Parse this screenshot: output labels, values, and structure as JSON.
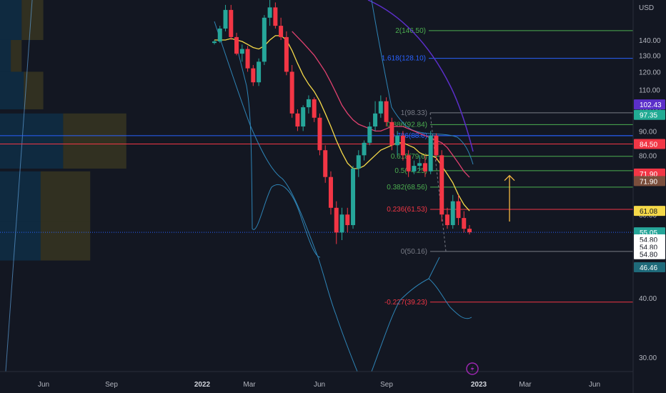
{
  "chart_data": {
    "type": "candlestick",
    "currency": "USD",
    "y_axis": {
      "scale": "log",
      "range": [
        28,
        170
      ],
      "ticks": [
        30,
        40,
        50,
        60,
        70,
        80,
        90,
        100,
        110,
        120,
        130,
        140
      ]
    },
    "x_axis": {
      "tick_labels": [
        "Jun",
        "Sep",
        "2022",
        "Mar",
        "Jun",
        "Sep",
        "2023",
        "Mar",
        "Jun"
      ],
      "bold_labels": [
        "2022",
        "2023"
      ]
    },
    "grid": false,
    "candles": [
      [
        138,
        140,
        137,
        139
      ],
      [
        139,
        150,
        138,
        148
      ],
      [
        148,
        166,
        146,
        162
      ],
      [
        162,
        166,
        140,
        142
      ],
      [
        142,
        145,
        130,
        131
      ],
      [
        131,
        137,
        126,
        134
      ],
      [
        134,
        136,
        120,
        122
      ],
      [
        122,
        124,
        112,
        114
      ],
      [
        114,
        128,
        112,
        126
      ],
      [
        126,
        158,
        124,
        156
      ],
      [
        156,
        170,
        150,
        164
      ],
      [
        164,
        168,
        148,
        150
      ],
      [
        150,
        156,
        140,
        142
      ],
      [
        142,
        146,
        118,
        120
      ],
      [
        120,
        124,
        96,
        98
      ],
      [
        98,
        100,
        90,
        92
      ],
      [
        92,
        102,
        90,
        101
      ],
      [
        101,
        107,
        98,
        105
      ],
      [
        105,
        106,
        94,
        96
      ],
      [
        96,
        98,
        80,
        82
      ],
      [
        82,
        84,
        70,
        72
      ],
      [
        72,
        74,
        60,
        62
      ],
      [
        62,
        64,
        52,
        55
      ],
      [
        55,
        62,
        53,
        60
      ],
      [
        60,
        62,
        55,
        57
      ],
      [
        57,
        76,
        56,
        75
      ],
      [
        75,
        82,
        72,
        80
      ],
      [
        80,
        86,
        78,
        85
      ],
      [
        85,
        94,
        84,
        92
      ],
      [
        92,
        104,
        90,
        98
      ],
      [
        98,
        107,
        96,
        104
      ],
      [
        104,
        106,
        92,
        94
      ],
      [
        94,
        96,
        82,
        84
      ],
      [
        84,
        90,
        80,
        88
      ],
      [
        88,
        90,
        78,
        80
      ],
      [
        80,
        82,
        72,
        74
      ],
      [
        74,
        78,
        73,
        76
      ],
      [
        76,
        80,
        74,
        77
      ],
      [
        77,
        80,
        72,
        74
      ],
      [
        74,
        90,
        73,
        88
      ],
      [
        88,
        89,
        78,
        80
      ],
      [
        80,
        82,
        58,
        60
      ],
      [
        60,
        62,
        56,
        57
      ],
      [
        57,
        66,
        56,
        64
      ],
      [
        64,
        66,
        57,
        59
      ],
      [
        59,
        61,
        55,
        56
      ],
      [
        56,
        57,
        54.5,
        55.05
      ]
    ],
    "moving_averages": [
      {
        "name": "",
        "color": "#f5d949",
        "values": [
          140,
          140,
          140,
          141,
          140,
          139,
          137,
          135,
          134,
          136,
          140,
          143,
          143,
          140,
          133,
          125,
          118,
          113,
          109,
          104,
          98,
          92,
          86,
          81,
          77,
          75,
          75,
          76,
          78,
          80,
          82,
          83,
          84,
          85,
          85,
          84,
          83,
          81,
          80,
          80,
          79,
          76,
          73,
          70,
          66,
          63,
          61.08
        ]
      },
      {
        "name": "",
        "color": "#e0416f",
        "values": [
          null,
          null,
          null,
          null,
          null,
          null,
          null,
          null,
          null,
          null,
          null,
          null,
          null,
          null,
          146,
          142,
          138,
          134,
          130,
          125,
          120,
          114,
          108,
          102,
          98,
          95,
          93,
          92,
          91,
          90,
          90,
          91,
          92,
          92,
          92,
          91,
          90,
          89,
          88,
          87,
          86,
          85,
          83,
          80,
          77,
          74,
          71.9
        ]
      }
    ],
    "bollinger": {
      "upper": [
        null,
        null,
        null,
        null,
        null,
        null,
        null,
        null,
        null,
        null,
        null,
        null,
        null,
        null,
        null,
        null,
        null,
        null,
        null,
        null,
        null,
        null,
        null,
        null,
        null,
        null,
        null,
        null,
        null,
        null,
        120,
        117,
        114,
        111,
        108,
        106,
        104,
        103,
        102,
        101,
        null,
        null,
        null,
        null,
        null,
        null,
        null
      ],
      "middle_note": "",
      "lower": [
        null,
        null,
        null,
        null,
        null,
        null,
        null,
        null,
        null,
        null,
        null,
        null,
        null,
        null,
        null,
        null,
        null,
        null,
        null,
        null,
        null,
        null,
        null,
        null,
        null,
        null,
        null,
        null,
        null,
        null,
        null,
        null,
        null,
        null,
        null,
        null,
        null,
        null,
        null,
        null,
        null,
        null,
        null,
        null,
        null,
        null,
        null
      ]
    },
    "horizontal_lines": [
      {
        "name": "red-level",
        "price": 84.5,
        "color": "#f23645"
      },
      {
        "name": "blue-level",
        "price": 88.0,
        "color": "#2962ff"
      },
      {
        "name": "current-price",
        "price": 55.05,
        "color": "#2962ff",
        "dotted": true
      }
    ],
    "fib_upper": [
      {
        "label": "2(146.50)",
        "price": 146.5,
        "color": "#4caf50"
      },
      {
        "label": "1.618(128.10)",
        "price": 128.1,
        "color": "#2962ff"
      }
    ],
    "fib_levels": [
      {
        "label": "1(98.33)",
        "price": 98.33,
        "color": "#787b86"
      },
      {
        "label": "0.886(92.84)",
        "price": 92.84,
        "color": "#4caf50"
      },
      {
        "label": "0.786(88.0)",
        "price": 88.0,
        "color": "#2962ff"
      },
      {
        "label": "0.618(79.6)",
        "price": 79.6,
        "color": "#4caf50"
      },
      {
        "label": "0.5(74.25)",
        "price": 74.25,
        "color": "#4caf50"
      },
      {
        "label": "0.382(68.56)",
        "price": 68.56,
        "color": "#4caf50"
      },
      {
        "label": "0.236(61.53)",
        "price": 61.53,
        "color": "#f23645"
      },
      {
        "label": "0(50.16)",
        "price": 50.16,
        "color": "#787b86"
      },
      {
        "label": "-0.227(39.23)",
        "price": 39.23,
        "color": "#f23645"
      }
    ],
    "price_tags": [
      {
        "text": "102.43",
        "price": 102.43,
        "bg": "#5b2fc9",
        "fg": "#ffffff"
      },
      {
        "text": "97.35",
        "price": 97.35,
        "bg": "#22ab94",
        "fg": "#ffffff"
      },
      {
        "text": "84.50",
        "price": 84.5,
        "bg": "#f23645",
        "fg": "#ffffff"
      },
      {
        "text": "71.90",
        "price": 73.2,
        "bg": "#f23645",
        "fg": "#ffffff"
      },
      {
        "text": "71.90",
        "price": 70.6,
        "bg": "#7a4e3c",
        "fg": "#ffffff"
      },
      {
        "text": "61.08",
        "price": 61.08,
        "bg": "#f5d949",
        "fg": "#131722"
      },
      {
        "text": "55.05",
        "price": 55.05,
        "bg": "#26a69a",
        "fg": "#ffffff"
      },
      {
        "text": "54.80",
        "price": 53.2,
        "bg": "#ffffff",
        "fg": "#131722"
      },
      {
        "text": "54.80",
        "price": 51.3,
        "bg": "#ffffff",
        "fg": "#131722"
      },
      {
        "text": "54.80",
        "price": 49.5,
        "bg": "#ffffff",
        "fg": "#131722"
      },
      {
        "text": "46.46",
        "price": 46.46,
        "bg": "#1f6a7a",
        "fg": "#ffffff"
      }
    ],
    "volume_profile": [
      {
        "from": 140,
        "to": 170,
        "total": 0.12,
        "up_share": 0.5
      },
      {
        "from": 120,
        "to": 140,
        "total": 0.06,
        "up_share": 0.5
      },
      {
        "from": 100,
        "to": 120,
        "total": 0.12,
        "up_share": 0.55
      },
      {
        "from": 75,
        "to": 98,
        "total": 0.35,
        "up_share": 0.5
      },
      {
        "from": 58,
        "to": 74,
        "total": 0.25,
        "up_share": 0.45
      },
      {
        "from": 48,
        "to": 58,
        "total": 0.25,
        "up_share": 0.45
      }
    ],
    "colors": {
      "background": "#131722",
      "up": "#26a69a",
      "down": "#f23645",
      "text": "#d1d4dc",
      "axis_text": "#b2b5be",
      "arrow": "#f5b942"
    }
  },
  "axis": {
    "currency_label": "USD"
  }
}
